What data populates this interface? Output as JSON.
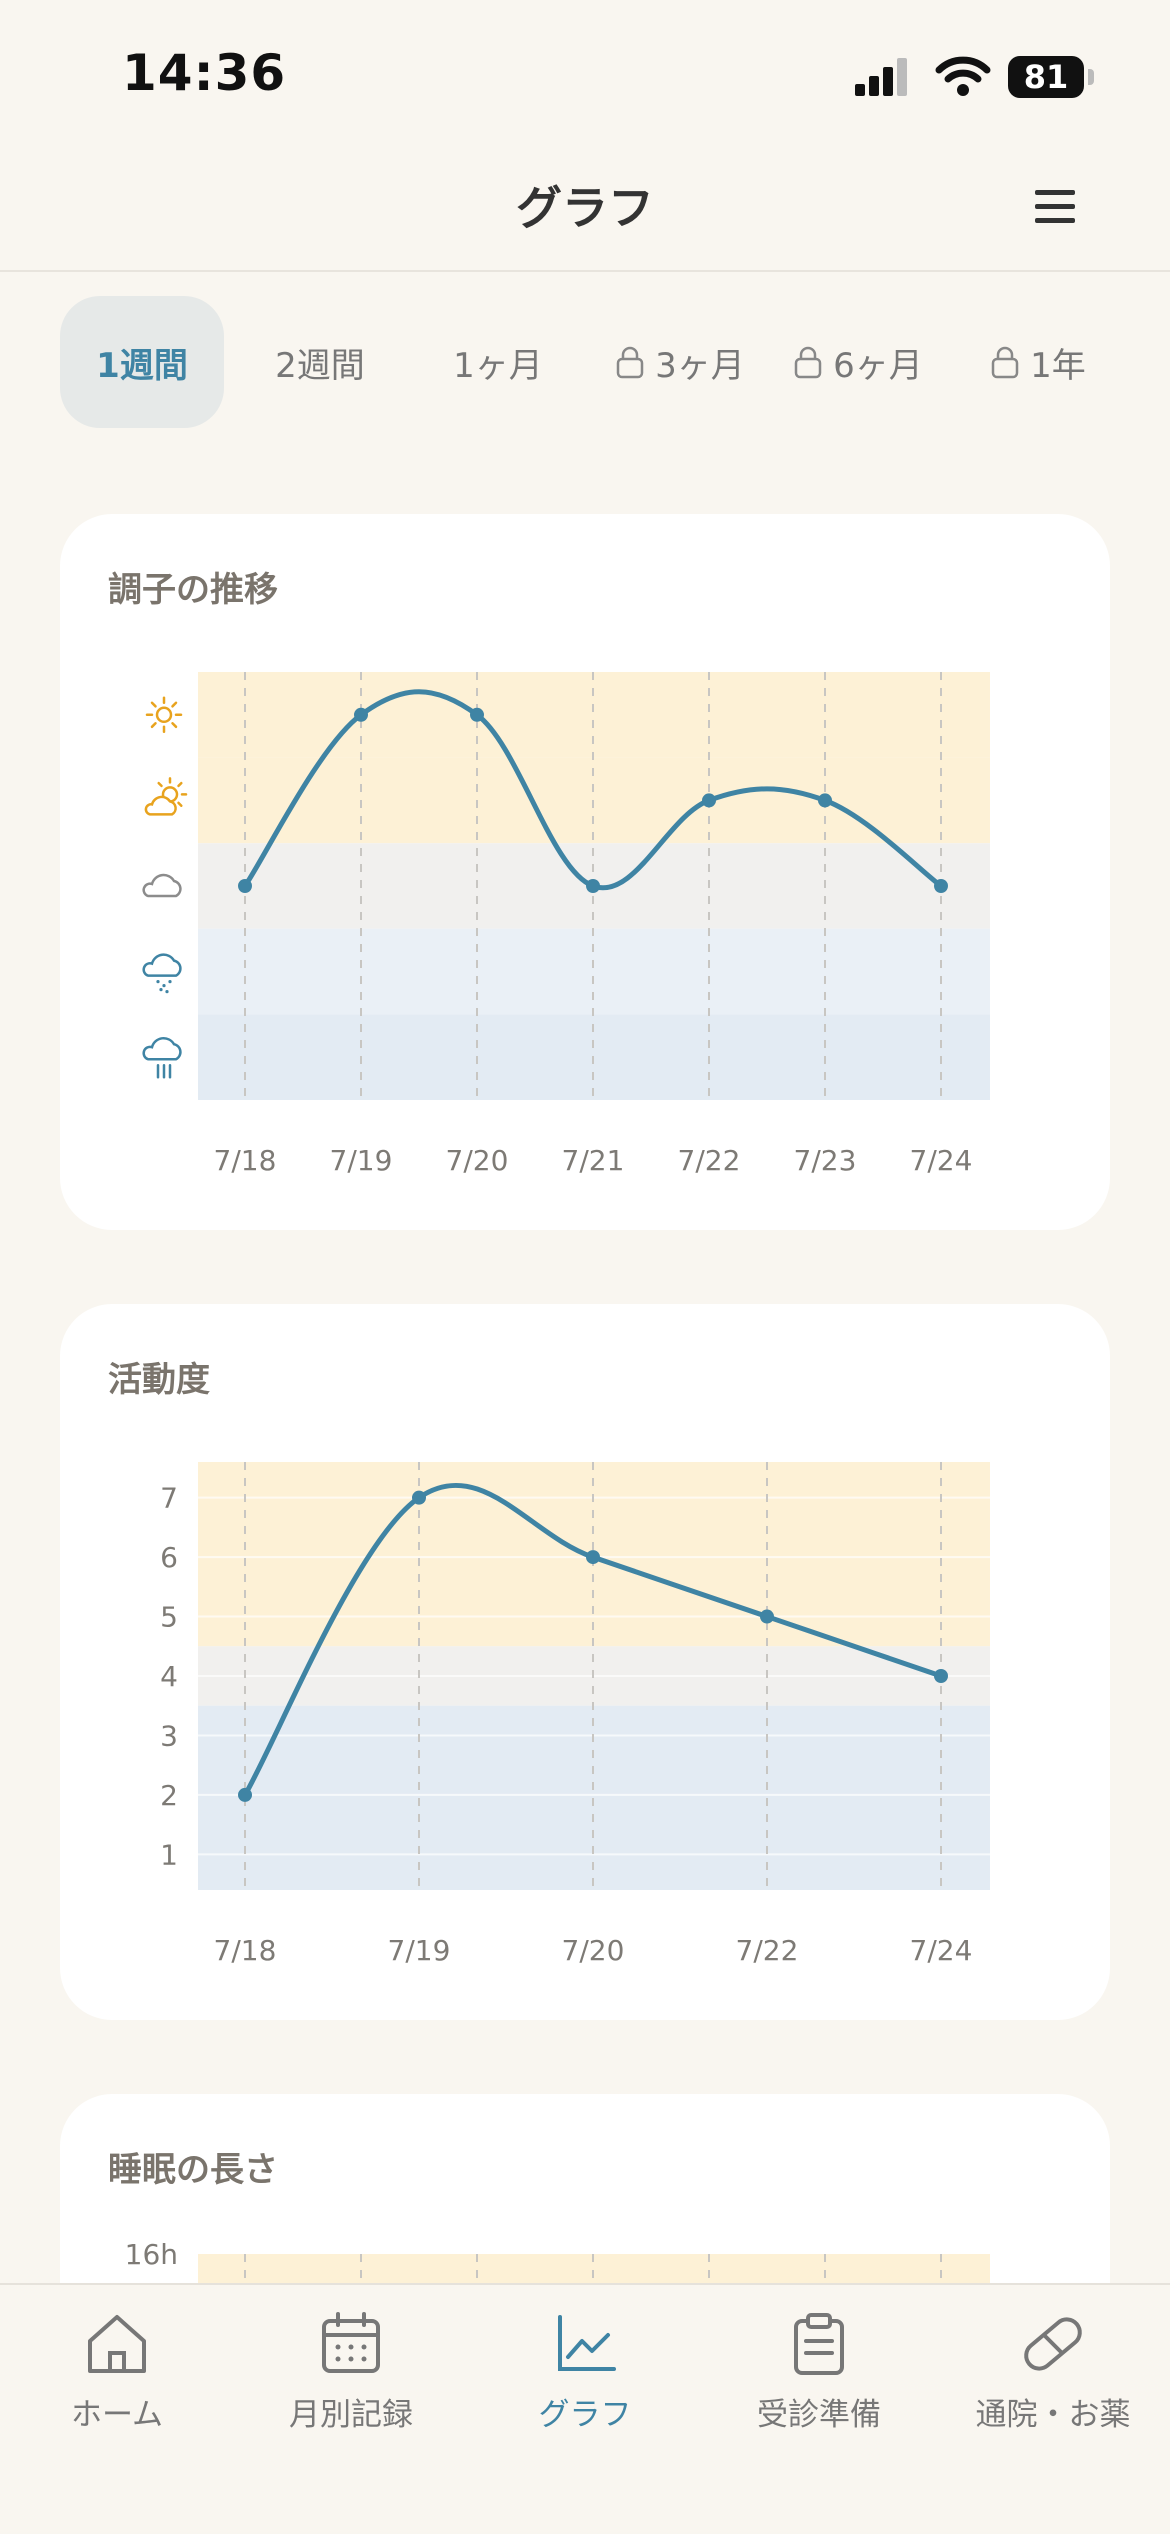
{
  "status": {
    "time": "14:36",
    "battery": "81"
  },
  "header": {
    "title": "グラフ"
  },
  "tabs": [
    {
      "label": "1週間",
      "active": true,
      "locked": false
    },
    {
      "label": "2週間",
      "active": false,
      "locked": false
    },
    {
      "label": "1ヶ月",
      "active": false,
      "locked": false
    },
    {
      "label": "3ヶ月",
      "active": false,
      "locked": true
    },
    {
      "label": "6ヶ月",
      "active": false,
      "locked": true
    },
    {
      "label": "1年",
      "active": false,
      "locked": true
    }
  ],
  "condition_card": {
    "title": "調子の推移",
    "level_icons": [
      "sunny-icon",
      "partly-sunny-icon",
      "cloudy-icon",
      "drizzle-icon",
      "rain-icon"
    ]
  },
  "activity_card": {
    "title": "活動度"
  },
  "sleep_card": {
    "title": "睡眠の長さ"
  },
  "chart_data": [
    {
      "type": "line",
      "title": "調子の推移",
      "categories": [
        "7/18",
        "7/19",
        "7/20",
        "7/21",
        "7/22",
        "7/23",
        "7/24"
      ],
      "values": [
        3,
        5,
        5,
        3,
        4,
        4,
        3
      ],
      "ylim": [
        1,
        5
      ],
      "y_levels_as_icons": [
        "sunny",
        "partly-sunny",
        "cloudy",
        "drizzle",
        "rain"
      ],
      "color": "#3f84a4"
    },
    {
      "type": "line",
      "title": "活動度",
      "categories": [
        "7/18",
        "7/19",
        "7/20",
        "7/22",
        "7/24"
      ],
      "values": [
        2,
        7,
        6,
        5,
        4
      ],
      "yticks": [
        1,
        2,
        3,
        4,
        5,
        6,
        7
      ],
      "ylim": [
        0.4,
        7.6
      ],
      "color": "#3f84a4"
    },
    {
      "type": "line",
      "title": "睡眠の長さ",
      "yticks_visible": [
        "16h"
      ]
    }
  ],
  "nav": [
    {
      "label": "ホーム",
      "icon": "home-icon",
      "active": false
    },
    {
      "label": "月別記録",
      "icon": "calendar-icon",
      "active": false
    },
    {
      "label": "グラフ",
      "icon": "chart-icon",
      "active": true
    },
    {
      "label": "受診準備",
      "icon": "clipboard-icon",
      "active": false
    },
    {
      "label": "通院・お薬",
      "icon": "pill-icon",
      "active": false
    }
  ],
  "colors": {
    "accent": "#3f84a4",
    "good_band": "#fdf1d6",
    "neutral_band": "#f1f0ee",
    "bad_band": "#e3ebf3"
  }
}
